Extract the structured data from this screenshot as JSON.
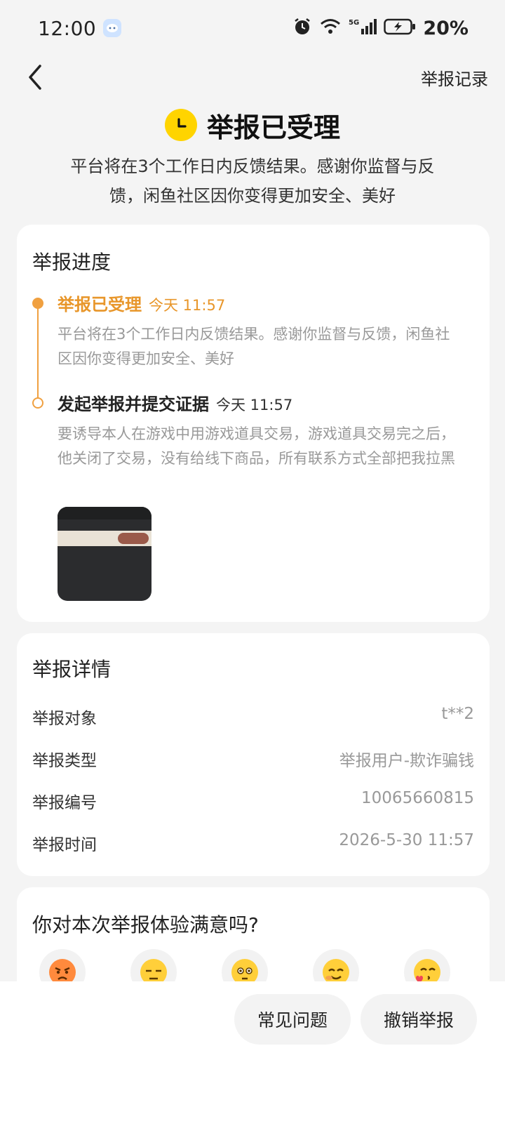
{
  "status_bar": {
    "time": "12:00",
    "battery": "20%",
    "icons": [
      "mascot-icon",
      "alarm-icon",
      "wifi-icon",
      "signal-5g-icon",
      "battery-charging-icon"
    ]
  },
  "nav": {
    "back_icon": "chevron-left-icon",
    "records_label": "举报记录"
  },
  "hero": {
    "icon": "clock-icon",
    "title": "举报已受理",
    "subtitle": "平台将在3个工作日内反馈结果。感谢你监督与反馈，闲鱼社区因你变得更加安全、美好"
  },
  "progress": {
    "title": "举报进度",
    "accent_color": "#e8962a",
    "items": [
      {
        "name": "举报已受理",
        "time": "今天 11:57",
        "desc": "平台将在3个工作日内反馈结果。感谢你监督与反馈，闲鱼社区因你变得更加安全、美好"
      },
      {
        "name": "发起举报并提交证据",
        "time": "今天 11:57",
        "desc": "要诱导本人在游戏中用游戏道具交易，游戏道具交易完之后，他关闭了交易，没有给线下商品，所有联系方式全部把我拉黑"
      }
    ]
  },
  "details": {
    "title": "举报详情",
    "rows": [
      {
        "key": "举报对象",
        "value": "t**2"
      },
      {
        "key": "举报类型",
        "value": "举报用户-欺诈骗钱"
      },
      {
        "key": "举报编号",
        "value": "10065660815"
      },
      {
        "key": "举报时间",
        "value": "2026-5-30 11:57"
      }
    ]
  },
  "survey": {
    "title": "你对本次举报体验满意吗?",
    "options": [
      "angry-face-icon",
      "unamused-face-icon",
      "neutral-face-icon",
      "smiling-face-icon",
      "kissing-face-icon"
    ]
  },
  "bottom": {
    "faq_label": "常见问题",
    "cancel_label": "撤销举报"
  }
}
